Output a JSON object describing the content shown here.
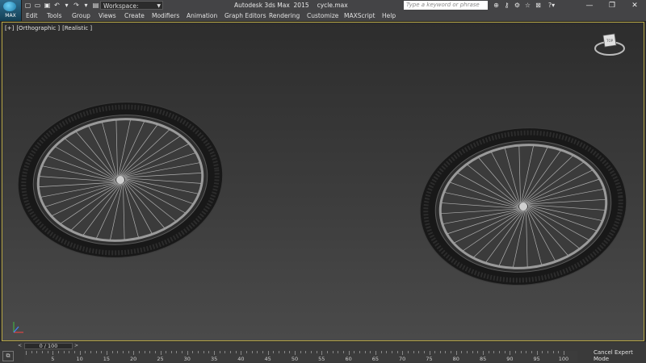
{
  "app": {
    "logo_label": "MAX",
    "title": "Autodesk 3ds Max  2015",
    "file": "cycle.max",
    "workspace": "Workspace: Default",
    "search_placeholder": "Type a keyword or phrase"
  },
  "quick_access": [
    "new-file-icon",
    "open-file-icon",
    "save-icon",
    "undo-icon",
    "undo-dropdown-icon",
    "redo-icon",
    "redo-dropdown-icon",
    "project-folder-icon",
    "dropdown-icon"
  ],
  "search_icons": [
    "binoculars-icon",
    "key-icon",
    "tools-icon",
    "star-icon",
    "close-x-icon",
    "help-icon"
  ],
  "window_controls": {
    "minimize": "—",
    "restore": "❐",
    "close": "✕"
  },
  "menu": [
    "Edit",
    "Tools",
    "Group",
    "Views",
    "Create",
    "Modifiers",
    "Animation",
    "Graph Editors",
    "Rendering",
    "Customize",
    "MAXScript",
    "Help"
  ],
  "viewport": {
    "labels": [
      "[+]",
      "[Orthographic ]",
      "[Realistic ]"
    ],
    "viewcube_face": "TOP"
  },
  "timeline": {
    "slider_text": "0 / 100",
    "ticks": [
      "0",
      "5",
      "10",
      "15",
      "20",
      "25",
      "30",
      "35",
      "40",
      "45",
      "50",
      "55",
      "60",
      "65",
      "70",
      "75",
      "80",
      "85",
      "90",
      "95",
      "100"
    ],
    "cancel_label": "Cancel Expert Mode"
  },
  "colors": {
    "viewport_border": "#b7a646",
    "ui_dark": "#444446"
  }
}
